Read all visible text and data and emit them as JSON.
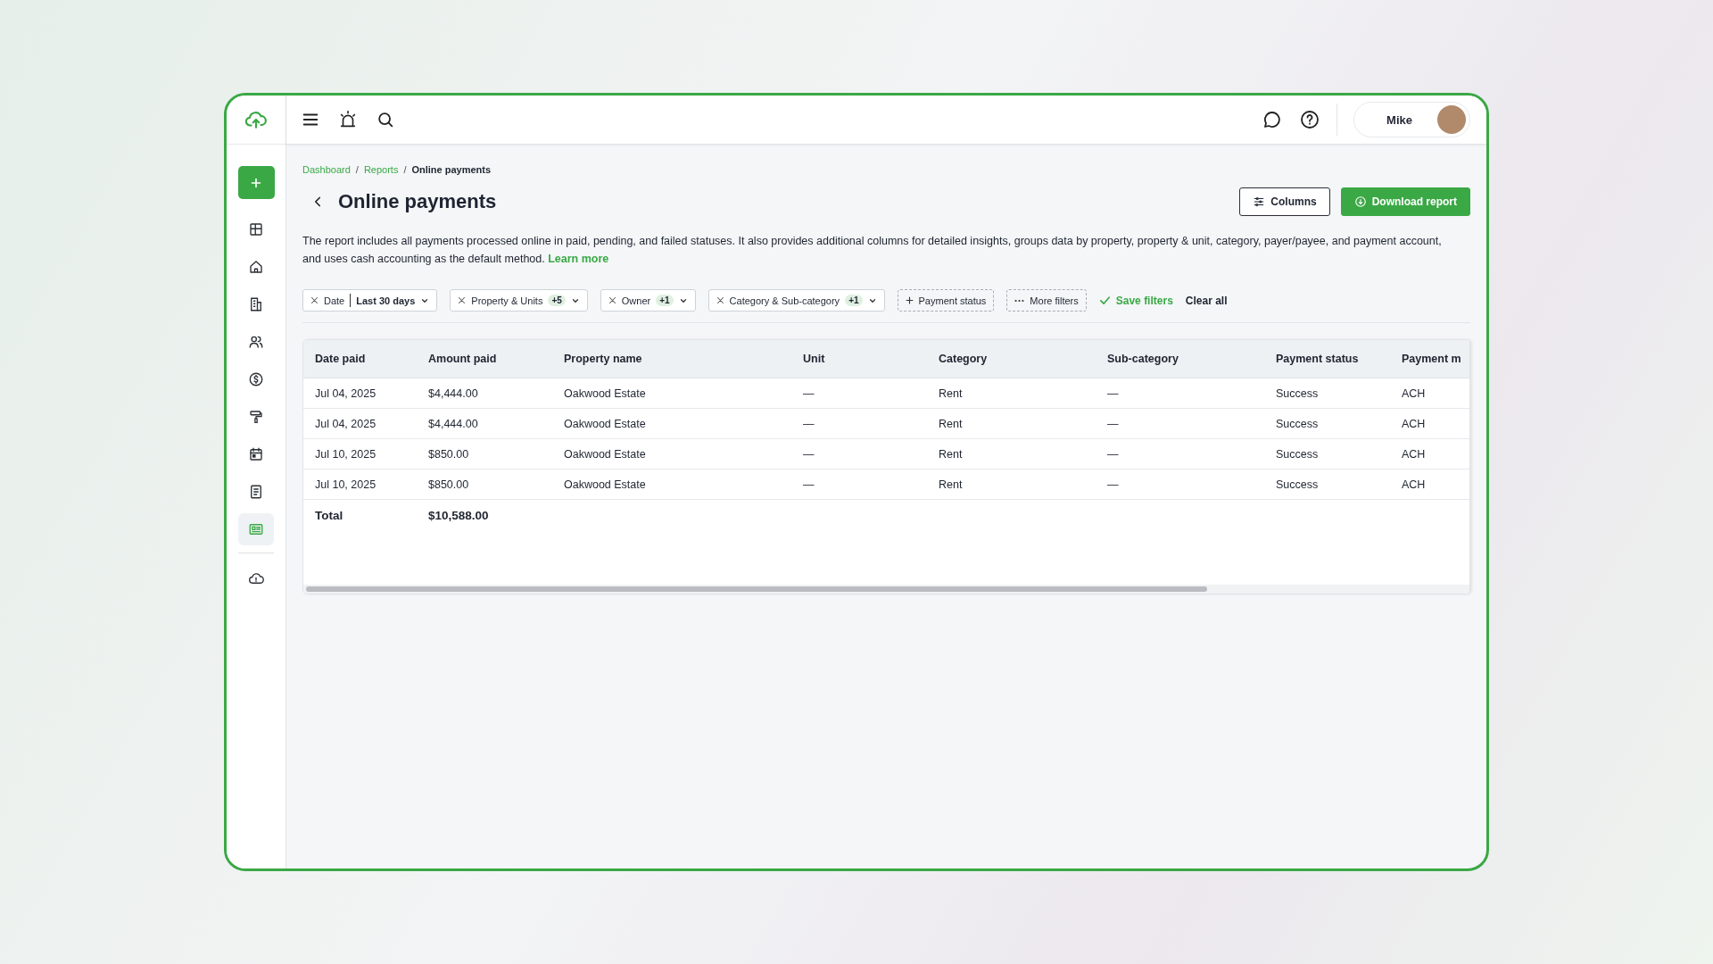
{
  "sidebar": {
    "items": [
      {
        "kind": "add"
      },
      {
        "kind": "grid",
        "selected": false
      },
      {
        "kind": "home",
        "selected": false
      },
      {
        "kind": "building",
        "selected": false
      },
      {
        "kind": "people",
        "selected": false
      },
      {
        "kind": "dollar",
        "selected": false
      },
      {
        "kind": "roller",
        "selected": false
      },
      {
        "kind": "calendar",
        "selected": false
      },
      {
        "kind": "document",
        "selected": false
      },
      {
        "kind": "report",
        "selected": true
      },
      {
        "kind": "divider"
      },
      {
        "kind": "cloud-alert",
        "selected": false
      }
    ]
  },
  "topbar": {
    "user": {
      "name": "Mike"
    }
  },
  "breadcrumb": {
    "separator": "/",
    "items": [
      {
        "label": "Dashboard",
        "current": false
      },
      {
        "label": "Reports",
        "current": false
      },
      {
        "label": "Online payments",
        "current": true
      }
    ]
  },
  "title": "Online payments",
  "buttons": {
    "columns": "Columns",
    "download": "Download report"
  },
  "description": {
    "text": "The report includes all payments processed online in paid, pending, and failed statuses. It also provides additional columns for detailed insights, groups data by property, property & unit, category, payer/payee, and payment account, and uses cash accounting as the default method.",
    "link": "Learn more"
  },
  "filters": [
    {
      "kind": "chip",
      "label": "Date",
      "value": "Last 30 days"
    },
    {
      "kind": "chip",
      "label": "Property & Units",
      "count": "+5"
    },
    {
      "kind": "chip",
      "label": "Owner",
      "count": "+1"
    },
    {
      "kind": "chip",
      "label": "Category & Sub-category",
      "count": "+1"
    },
    {
      "kind": "add",
      "label": "Payment status"
    },
    {
      "kind": "more",
      "label": "More filters"
    }
  ],
  "filter_actions": {
    "save": "Save filters",
    "clear": "Clear all"
  },
  "table": {
    "columns": [
      "Date paid",
      "Amount paid",
      "Property name",
      "Unit",
      "Category",
      "Sub-category",
      "Payment status",
      "Payment m"
    ],
    "rows": [
      [
        "Jul 04, 2025",
        "$4,444.00",
        "Oakwood Estate",
        "—",
        "Rent",
        "—",
        "Success",
        "ACH"
      ],
      [
        "Jul 04, 2025",
        "$4,444.00",
        "Oakwood Estate",
        "—",
        "Rent",
        "—",
        "Success",
        "ACH"
      ],
      [
        "Jul 10, 2025",
        "$850.00",
        "Oakwood Estate",
        "—",
        "Rent",
        "—",
        "Success",
        "ACH"
      ],
      [
        "Jul 10, 2025",
        "$850.00",
        "Oakwood Estate",
        "—",
        "Rent",
        "—",
        "Success",
        "ACH"
      ]
    ],
    "total": {
      "label": "Total",
      "amount": "$10,588.00"
    }
  }
}
